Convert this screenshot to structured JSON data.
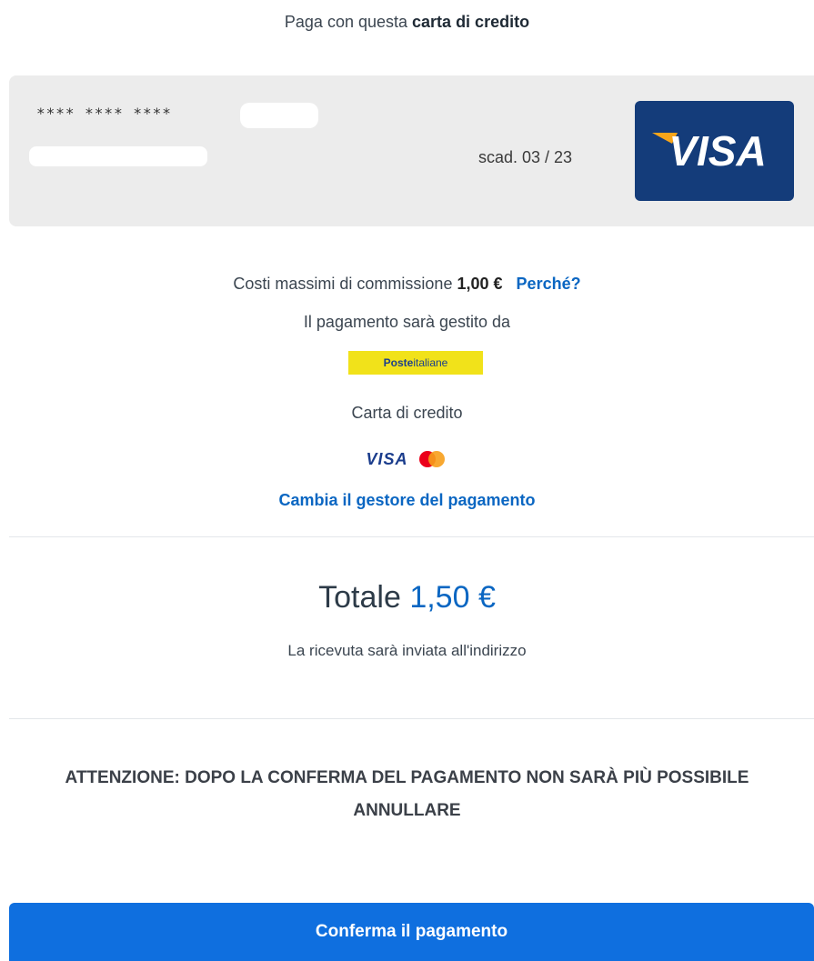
{
  "heading": {
    "prefix": "Paga con questa",
    "strong": "carta di credito"
  },
  "card": {
    "masked_number": "**** **** ****",
    "expiry": "scad. 03 / 23",
    "brand_text": "VISA",
    "brand_color": "#143c7a"
  },
  "fees": {
    "label": "Costi massimi di commissione",
    "amount": "1,00 €",
    "why_link": "Perché?"
  },
  "handler": {
    "label": "Il pagamento sarà gestito da",
    "provider_bold": "Poste",
    "provider_rest": "italiane",
    "provider_color": "#f1e21a",
    "method": "Carta di credito",
    "brands": [
      "VISA",
      "mastercard-icon"
    ],
    "change_link": "Cambia il gestore del pagamento"
  },
  "total": {
    "label": "Totale",
    "amount": "1,50 €",
    "receipt_note": "La ricevuta sarà inviata all'indirizzo"
  },
  "warning": "ATTENZIONE: DOPO LA CONFERMA DEL PAGAMENTO NON SARÀ PIÙ POSSIBILE ANNULLARE",
  "confirm_button": "Conferma il pagamento",
  "accent_color": "#0f6fdf"
}
